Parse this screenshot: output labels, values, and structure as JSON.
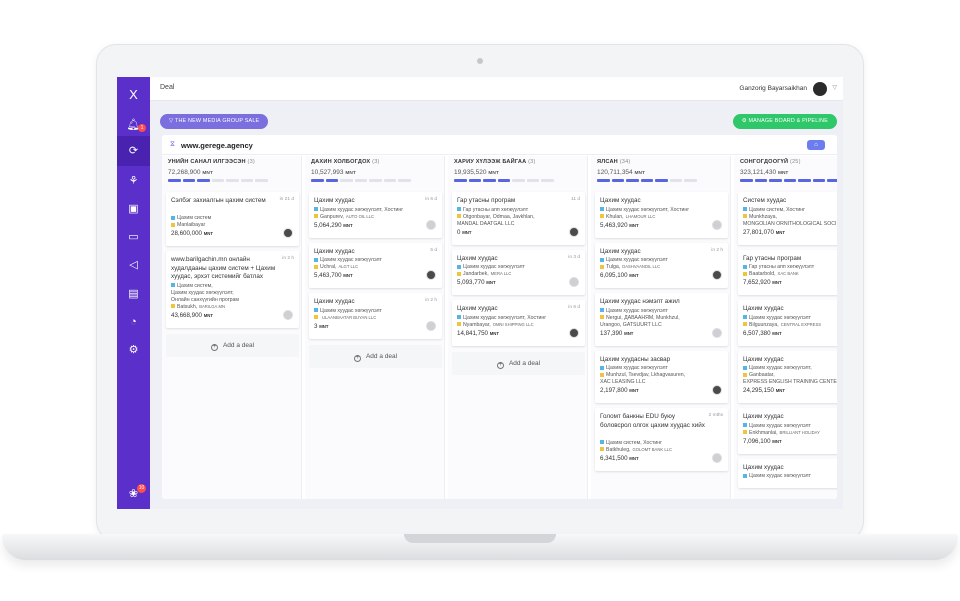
{
  "topbar": {
    "title": "Deal",
    "user": "Ganzorig Bayarsaikhan"
  },
  "pills": {
    "group": "▽ THE NEW MEDIA GROUP SALE",
    "manage": "⚙ MANAGE BOARD & PIPELINE"
  },
  "sidebar": {
    "logo": "X",
    "notif_count": "1",
    "mascot_count": "10"
  },
  "board": {
    "title": "www.gerege.agency",
    "add_deal_label": "Add a deal",
    "columns": [
      {
        "name": "УНИЙН САНАЛ ИЛГЭЭСЭН",
        "count": "(3)",
        "total": "72,268,900",
        "unit": "MNT",
        "progress": 3,
        "segments": 7,
        "cards": [
          {
            "title": "Сэлбэг захиалгын цахим систем",
            "age": "in 21 d",
            "lines": [
              {
                "dot": "blue",
                "text": "Цахим систем",
                "org": ""
              },
              {
                "dot": "yellow",
                "text": "Manlaibayar",
                "org": ""
              }
            ],
            "plain": [],
            "amount": "28,600,000",
            "unit": "MNT"
          },
          {
            "title": "www.barilgachin.mn онлайн худалдааны цахим систем + Цахим хуудас, эрхэт системийг батлах",
            "age": "in 2 h",
            "lines": [
              {
                "dot": "blue",
                "text": "Цахим систем,",
                "org": ""
              }
            ],
            "plain": [
              "Цахим хуудас хөгжүүлэлт,",
              "Онлайн санхүүгийн програм"
            ],
            "lines2": [
              {
                "dot": "yellow",
                "text": "Batsukh,",
                "org": "BARILGA.MN"
              }
            ],
            "amount": "43,668,900",
            "unit": "MNT"
          }
        ]
      },
      {
        "name": "ДАХИН ХОЛБОГДОХ",
        "count": "(3)",
        "total": "10,527,993",
        "unit": "MNT",
        "progress": 2,
        "segments": 7,
        "cards": [
          {
            "title": "Цахим хуудас",
            "age": "in 6 d",
            "lines": [
              {
                "dot": "blue",
                "text": "Цахим хуудас хөгжүүлэлт, Хостинг",
                "org": ""
              },
              {
                "dot": "yellow",
                "text": "Ganpurev,",
                "org": "AUTO OIL LLC"
              }
            ],
            "plain": [],
            "amount": "5,064,290",
            "unit": "MNT"
          },
          {
            "title": "Цахим хуудас",
            "age": "5 d",
            "lines": [
              {
                "dot": "blue",
                "text": "Цахим хуудас хөгжүүлэлт",
                "org": ""
              },
              {
                "dot": "yellow",
                "text": "Uchral,",
                "org": "ALGT LLC"
              }
            ],
            "plain": [],
            "amount": "5,463,700",
            "unit": "MNT"
          },
          {
            "title": "Цахим хуудас",
            "age": "in 2 h",
            "lines": [
              {
                "dot": "blue",
                "text": "Цахим хуудас хөгжүүлэлт",
                "org": ""
              },
              {
                "dot": "yellow",
                "text": "",
                "org": "ULAANBAATAR BUYAN LLC"
              }
            ],
            "plain": [],
            "amount": "3",
            "unit": "MNT"
          }
        ]
      },
      {
        "name": "ХАРИУ ХҮЛЭЭЖ БАЙГАА",
        "count": "(3)",
        "total": "19,935,520",
        "unit": "MNT",
        "progress": 4,
        "segments": 7,
        "cards": [
          {
            "title": "Гар утасны програм",
            "age": "11 d",
            "lines": [
              {
                "dot": "blue",
                "text": "Гар утасны апп хөгжүүлэлт",
                "org": ""
              },
              {
                "dot": "yellow",
                "text": "Otgonbayar, Odmaa, Javkhlan,",
                "org": ""
              }
            ],
            "plain": [
              "MANDAL DAATGAL LLC"
            ],
            "amount": "0",
            "unit": "MNT"
          },
          {
            "title": "Цахим хуудас",
            "age": "in 3 d",
            "lines": [
              {
                "dot": "blue",
                "text": "Цахим хуудас хөгжүүлэлт",
                "org": ""
              },
              {
                "dot": "yellow",
                "text": "Jandarbek,",
                "org": "MERA LLC"
              }
            ],
            "plain": [],
            "amount": "5,093,770",
            "unit": "MNT"
          },
          {
            "title": "Цахим хуудас",
            "age": "in 6 d",
            "lines": [
              {
                "dot": "blue",
                "text": "Цахим хуудас хөгжүүлэлт, Хостинг",
                "org": ""
              },
              {
                "dot": "yellow",
                "text": "Nyambayar,",
                "org": "OMNI SHIPPING LLC"
              }
            ],
            "plain": [],
            "amount": "14,841,750",
            "unit": "MNT"
          }
        ]
      },
      {
        "name": "ЯЛСАН",
        "count": "(34)",
        "total": "120,711,354",
        "unit": "MNT",
        "progress": 5,
        "segments": 7,
        "cards": [
          {
            "title": "Цахим хуудас",
            "age": "",
            "lines": [
              {
                "dot": "blue",
                "text": "Цахим хуудас хөгжүүлэлт, Хостинг",
                "org": ""
              },
              {
                "dot": "yellow",
                "text": "Khulan,",
                "org": "LHAMOUR LLC"
              }
            ],
            "plain": [],
            "amount": "5,463,920",
            "unit": "MNT"
          },
          {
            "title": "Цахим хуудас",
            "age": "in 2 h",
            "lines": [
              {
                "dot": "blue",
                "text": "Цахим хуудас хөгжүүлэлт",
                "org": ""
              },
              {
                "dot": "yellow",
                "text": "Tulga,",
                "org": "DASHVAANDIL LLC"
              }
            ],
            "plain": [],
            "amount": "6,095,100",
            "unit": "MNT"
          },
          {
            "title": "Цахим хуудас нэмэлт ажил",
            "age": "",
            "lines": [
              {
                "dot": "blue",
                "text": "Цахим хуудас хөгжүүлэлт",
                "org": ""
              },
              {
                "dot": "yellow",
                "text": "Nergui, ДАВААНЯМ, Munkhzul,",
                "org": ""
              }
            ],
            "plain": [
              "Urangoo, GATSUURT LLC"
            ],
            "amount": "137,390",
            "unit": "MNT"
          },
          {
            "title": "Цахим хуудасны засвар",
            "age": "",
            "lines": [
              {
                "dot": "blue",
                "text": "Цахим хуудас хөгжүүлэлт",
                "org": ""
              },
              {
                "dot": "yellow",
                "text": "Munhzul, Tsevdjav, Lkhagvasuren,",
                "org": ""
              }
            ],
            "plain": [
              "XAC LEASING LLC"
            ],
            "amount": "2,197,800",
            "unit": "MNT"
          },
          {
            "title": "Голомт банкны EDU буюу боловсрол олгох цахим хуудас хийх",
            "age": "2 mths",
            "lines": [
              {
                "dot": "blue",
                "text": "Цахим систем, Хостинг",
                "org": ""
              },
              {
                "dot": "yellow",
                "text": "Batkhuleg,",
                "org": "GOLOMT BANK LLC"
              }
            ],
            "plain": [],
            "amount": "6,341,500",
            "unit": "MNT"
          }
        ]
      },
      {
        "name": "СОНГОГДООГҮЙ",
        "count": "(25)",
        "total": "323,121,430",
        "unit": "MNT",
        "progress": 7,
        "segments": 7,
        "cards": [
          {
            "title": "Систем хуудас",
            "age": "",
            "lines": [
              {
                "dot": "blue",
                "text": "Цахим систем, Хостинг",
                "org": ""
              },
              {
                "dot": "yellow",
                "text": "Munkhzaya,",
                "org": ""
              }
            ],
            "plain": [
              "MONGOLIAN ORNITHOLOGICAL SOCI"
            ],
            "amount": "27,801,070",
            "unit": "MNT"
          },
          {
            "title": "Гар утасны програм",
            "age": "",
            "lines": [
              {
                "dot": "blue",
                "text": "Гар утасны апп хөгжүүлэлт",
                "org": ""
              },
              {
                "dot": "yellow",
                "text": "Baatarbold,",
                "org": "XAC BANK"
              }
            ],
            "plain": [],
            "amount": "7,652,920",
            "unit": "MNT"
          },
          {
            "title": "Цахим хуудас",
            "age": "",
            "lines": [
              {
                "dot": "blue",
                "text": "Цахим хуудас хөгжүүлэлт",
                "org": ""
              },
              {
                "dot": "yellow",
                "text": "Bilguunzaya,",
                "org": "CENTRAL EXPRESS"
              }
            ],
            "plain": [],
            "amount": "6,507,380",
            "unit": "MNT"
          },
          {
            "title": "Цахим хуудас",
            "age": "",
            "lines": [
              {
                "dot": "blue",
                "text": "Цахим хуудас хөгжүүлэлт,",
                "org": ""
              },
              {
                "dot": "yellow",
                "text": "Ganbaatar,",
                "org": ""
              }
            ],
            "plain": [
              "EXPRESS ENGLISH TRAINING CENTER"
            ],
            "amount": "24,295,150",
            "unit": "MNT"
          },
          {
            "title": "Цахим хуудас",
            "age": "",
            "lines": [
              {
                "dot": "blue",
                "text": "Цахим хуудас хөгжүүлэлт",
                "org": ""
              },
              {
                "dot": "yellow",
                "text": "Enkhmanlai,",
                "org": "BRILLIANT HOLIDAY"
              }
            ],
            "plain": [],
            "amount": "7,096,100",
            "unit": "MNT"
          },
          {
            "title": "Цахим хуудас",
            "age": "",
            "lines": [
              {
                "dot": "blue",
                "text": "Цахим хуудас хөгжүүлэлт",
                "org": ""
              }
            ],
            "plain": [],
            "amount": "",
            "unit": ""
          }
        ]
      }
    ]
  }
}
